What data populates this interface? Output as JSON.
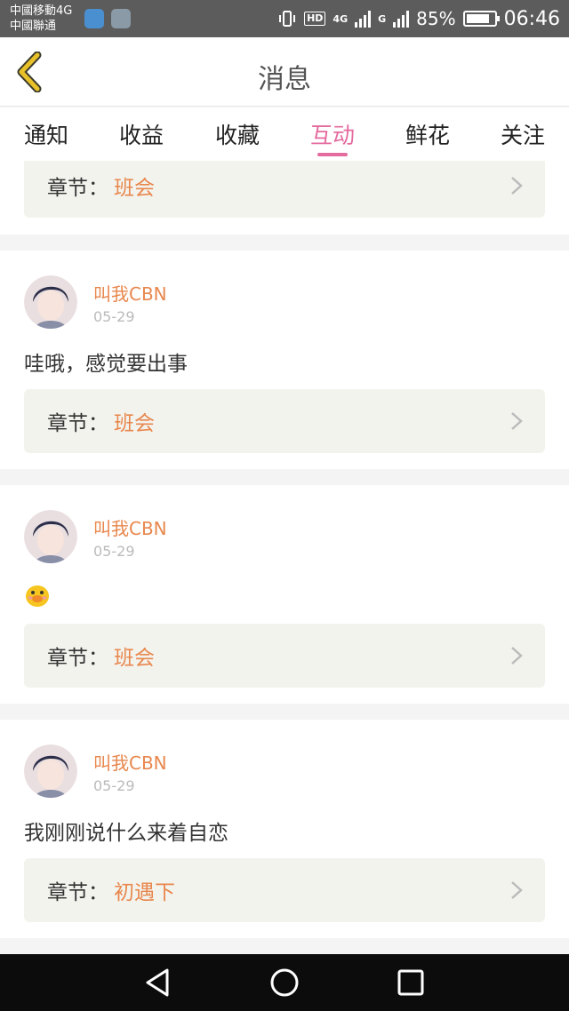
{
  "status_bar": {
    "carrier_line1": "中國移動4G",
    "carrier_line2": "中國聯通",
    "hd_label": "HD",
    "net_4g": "4G",
    "net_g": "G",
    "battery_percent_text": "85%",
    "battery_level": 0.85,
    "time": "06:46"
  },
  "header": {
    "title": "消息",
    "back_icon": "chevron-left-icon",
    "back_color": "#e8c12a"
  },
  "tabs": [
    {
      "label": "通知",
      "active": false
    },
    {
      "label": "收益",
      "active": false
    },
    {
      "label": "收藏",
      "active": false
    },
    {
      "label": "互动",
      "active": true
    },
    {
      "label": "鲜花",
      "active": false
    },
    {
      "label": "关注",
      "active": false
    }
  ],
  "colors": {
    "accent_pink": "#e46b9e",
    "orange": "#e8874d"
  },
  "feed": {
    "partial_top_chapter": {
      "label": "章节：",
      "value": "班会"
    },
    "cards": [
      {
        "username": "叫我CBN",
        "date": "05-29",
        "comment": "哇哦，感觉要出事",
        "chapter_label": "章节：",
        "chapter_value": "班会"
      },
      {
        "username": "叫我CBN",
        "date": "05-29",
        "comment": "",
        "emoji": "duck-emoji",
        "chapter_label": "章节：",
        "chapter_value": "班会"
      },
      {
        "username": "叫我CBN",
        "date": "05-29",
        "comment": "我刚刚说什么来着自恋",
        "chapter_label": "章节：",
        "chapter_value": "初遇下"
      }
    ]
  },
  "nav_bar": {
    "back": "triangle-back-icon",
    "home": "circle-home-icon",
    "recent": "square-recent-icon"
  }
}
